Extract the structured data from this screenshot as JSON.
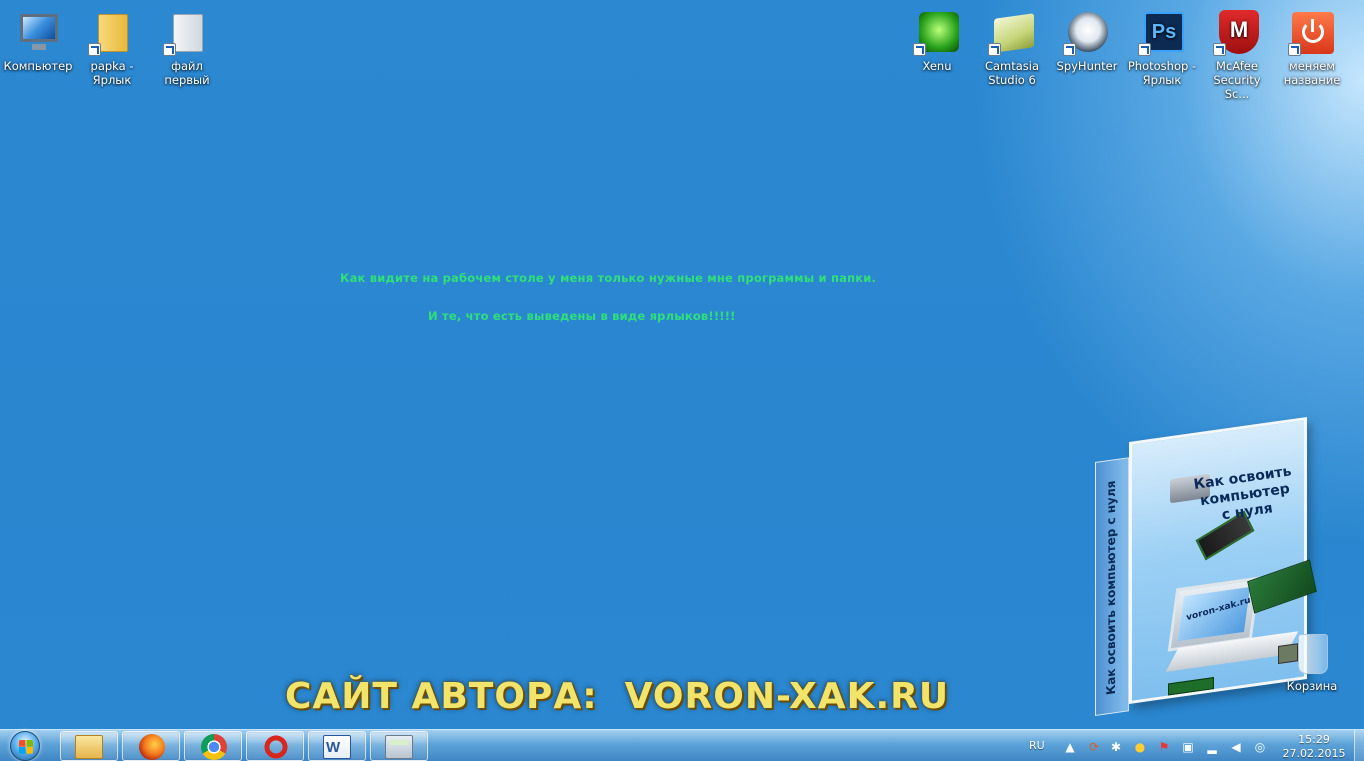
{
  "desktop": {
    "icons_left": [
      {
        "label": "Компьютер",
        "type": "computer"
      },
      {
        "label": "papka -\nЯрлык",
        "type": "folder-shortcut"
      },
      {
        "label": "файл\nпервый",
        "type": "file-shortcut"
      }
    ],
    "icons_right": [
      {
        "label": "Xenu",
        "type": "xenu"
      },
      {
        "label": "Camtasia\nStudio 6",
        "type": "camtasia"
      },
      {
        "label": "SpyHunter",
        "type": "spyhunter"
      },
      {
        "label": "Photoshop -\nЯрлык",
        "type": "photoshop",
        "glyph": "Ps"
      },
      {
        "label": "McAfee\nSecurity Sc...",
        "type": "mcafee",
        "glyph": "M"
      },
      {
        "label": "меняем\nназвание",
        "type": "power"
      }
    ],
    "recycle_bin": {
      "label": "Корзина"
    },
    "note_line1": "Как видите на рабочем столе у меня только нужные мне программы и папки.",
    "note_line2": "И те, что есть выведены в виде ярлыков!!!!!",
    "banner": "САЙТ АВТОРА:  VORON-XAK.RU",
    "book": {
      "title": "Как освоить\nкомпьютер\nс нуля",
      "spine": "Как освоить компьютер с нуля",
      "screen_text": "voron-xak.ru"
    }
  },
  "taskbar": {
    "start_icon": "windows-start-orb",
    "pinned": [
      "explorer-icon",
      "firefox-icon",
      "chrome-icon",
      "ccleaner-icon",
      "word-icon",
      "calculator-icon"
    ],
    "tray": {
      "language": "RU",
      "time": "15:29",
      "date": "27.02.2015"
    }
  },
  "colors": {
    "desktop_bg": "#2a86cf",
    "note_text": "#2fe07a",
    "banner_text": "#f2e36a"
  }
}
